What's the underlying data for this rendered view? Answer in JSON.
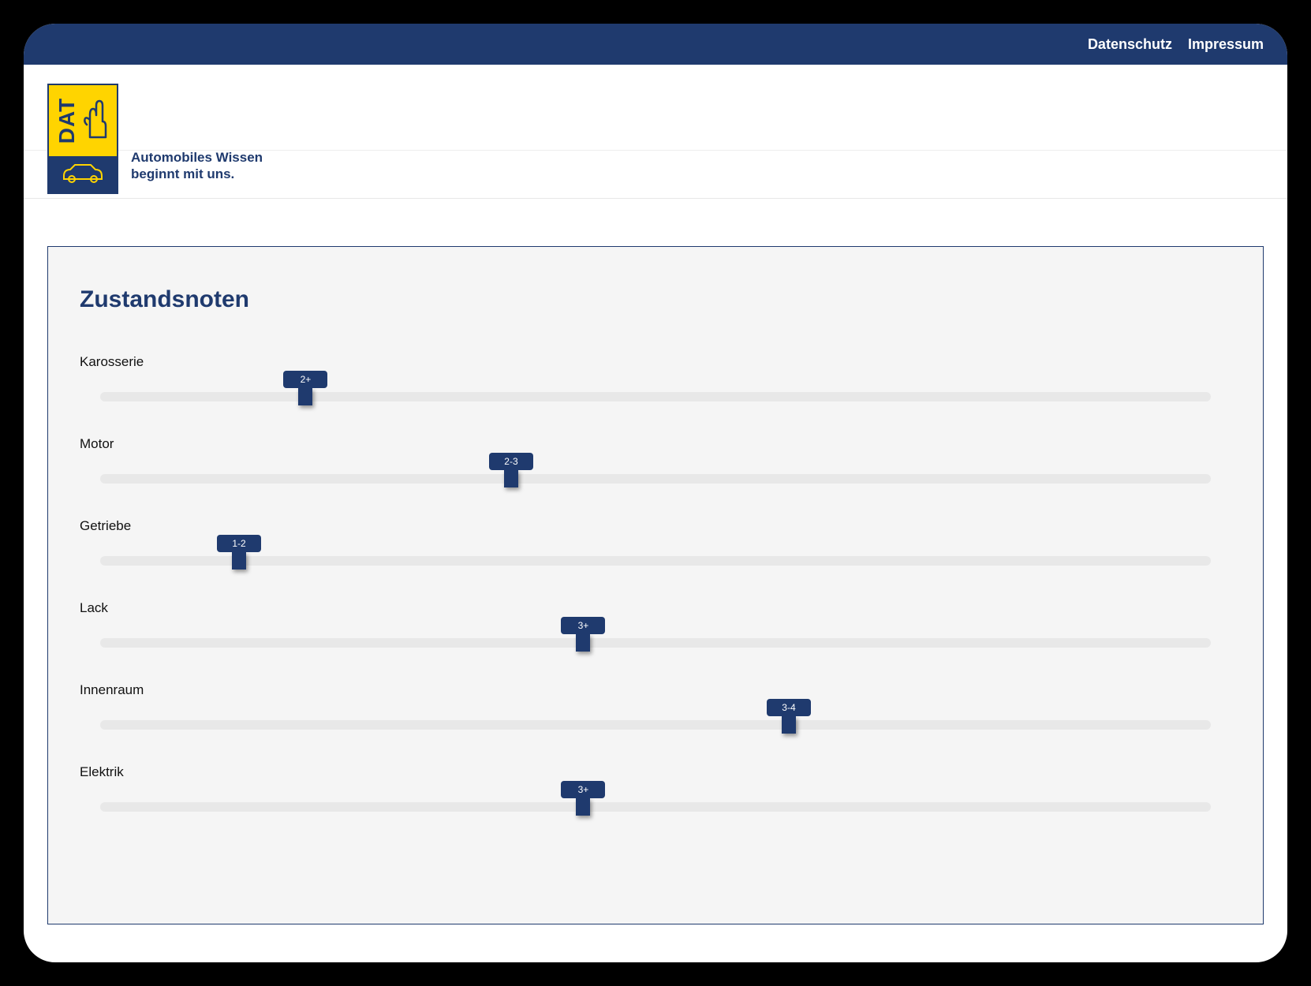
{
  "colors": {
    "primary": "#1f3a6e",
    "accent": "#ffd400",
    "track": "#e8e8e8",
    "panel_bg": "#f5f5f5"
  },
  "topnav": {
    "privacy_label": "Datenschutz",
    "imprint_label": "Impressum"
  },
  "logo": {
    "acronym": "DAT",
    "tagline_line1": "Automobiles Wissen",
    "tagline_line2": "beginnt mit uns."
  },
  "panel": {
    "title": "Zustandsnoten"
  },
  "sliders": [
    {
      "label": "Karosserie",
      "value_label": "2+",
      "position_pct": 18.5
    },
    {
      "label": "Motor",
      "value_label": "2-3",
      "position_pct": 37.0
    },
    {
      "label": "Getriebe",
      "value_label": "1-2",
      "position_pct": 12.5
    },
    {
      "label": "Lack",
      "value_label": "3+",
      "position_pct": 43.5
    },
    {
      "label": "Innenraum",
      "value_label": "3-4",
      "position_pct": 62.0
    },
    {
      "label": "Elektrik",
      "value_label": "3+",
      "position_pct": 43.5
    }
  ]
}
